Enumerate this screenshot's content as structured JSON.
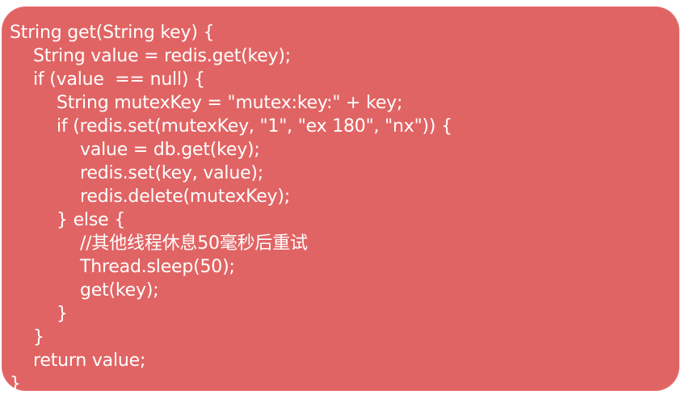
{
  "colors": {
    "card_background": "#e16464",
    "code_text": "#ffffff",
    "page_background": "#ffffff"
  },
  "code": {
    "lines": [
      {
        "indent": 0,
        "text": "String get(String key) {"
      },
      {
        "indent": 1,
        "text": "String value = redis.get(key);"
      },
      {
        "indent": 1,
        "text": "if (value  == null) {"
      },
      {
        "indent": 2,
        "text": "String mutexKey = \"mutex:key:\" + key;"
      },
      {
        "indent": 2,
        "text": "if (redis.set(mutexKey, \"1\", \"ex 180\", \"nx\")) {"
      },
      {
        "indent": 3,
        "text": "value = db.get(key);"
      },
      {
        "indent": 3,
        "text": "redis.set(key, value);"
      },
      {
        "indent": 3,
        "text": "redis.delete(mutexKey);"
      },
      {
        "indent": 2,
        "text": "} else {"
      },
      {
        "indent": 3,
        "text": "//其他线程休息50毫秒后重试"
      },
      {
        "indent": 3,
        "text": "Thread.sleep(50);"
      },
      {
        "indent": 3,
        "text": "get(key);"
      },
      {
        "indent": 2,
        "text": "}"
      },
      {
        "indent": 1,
        "text": "}"
      },
      {
        "indent": 1,
        "text": "return value;"
      },
      {
        "indent": 0,
        "text": "}"
      }
    ]
  }
}
